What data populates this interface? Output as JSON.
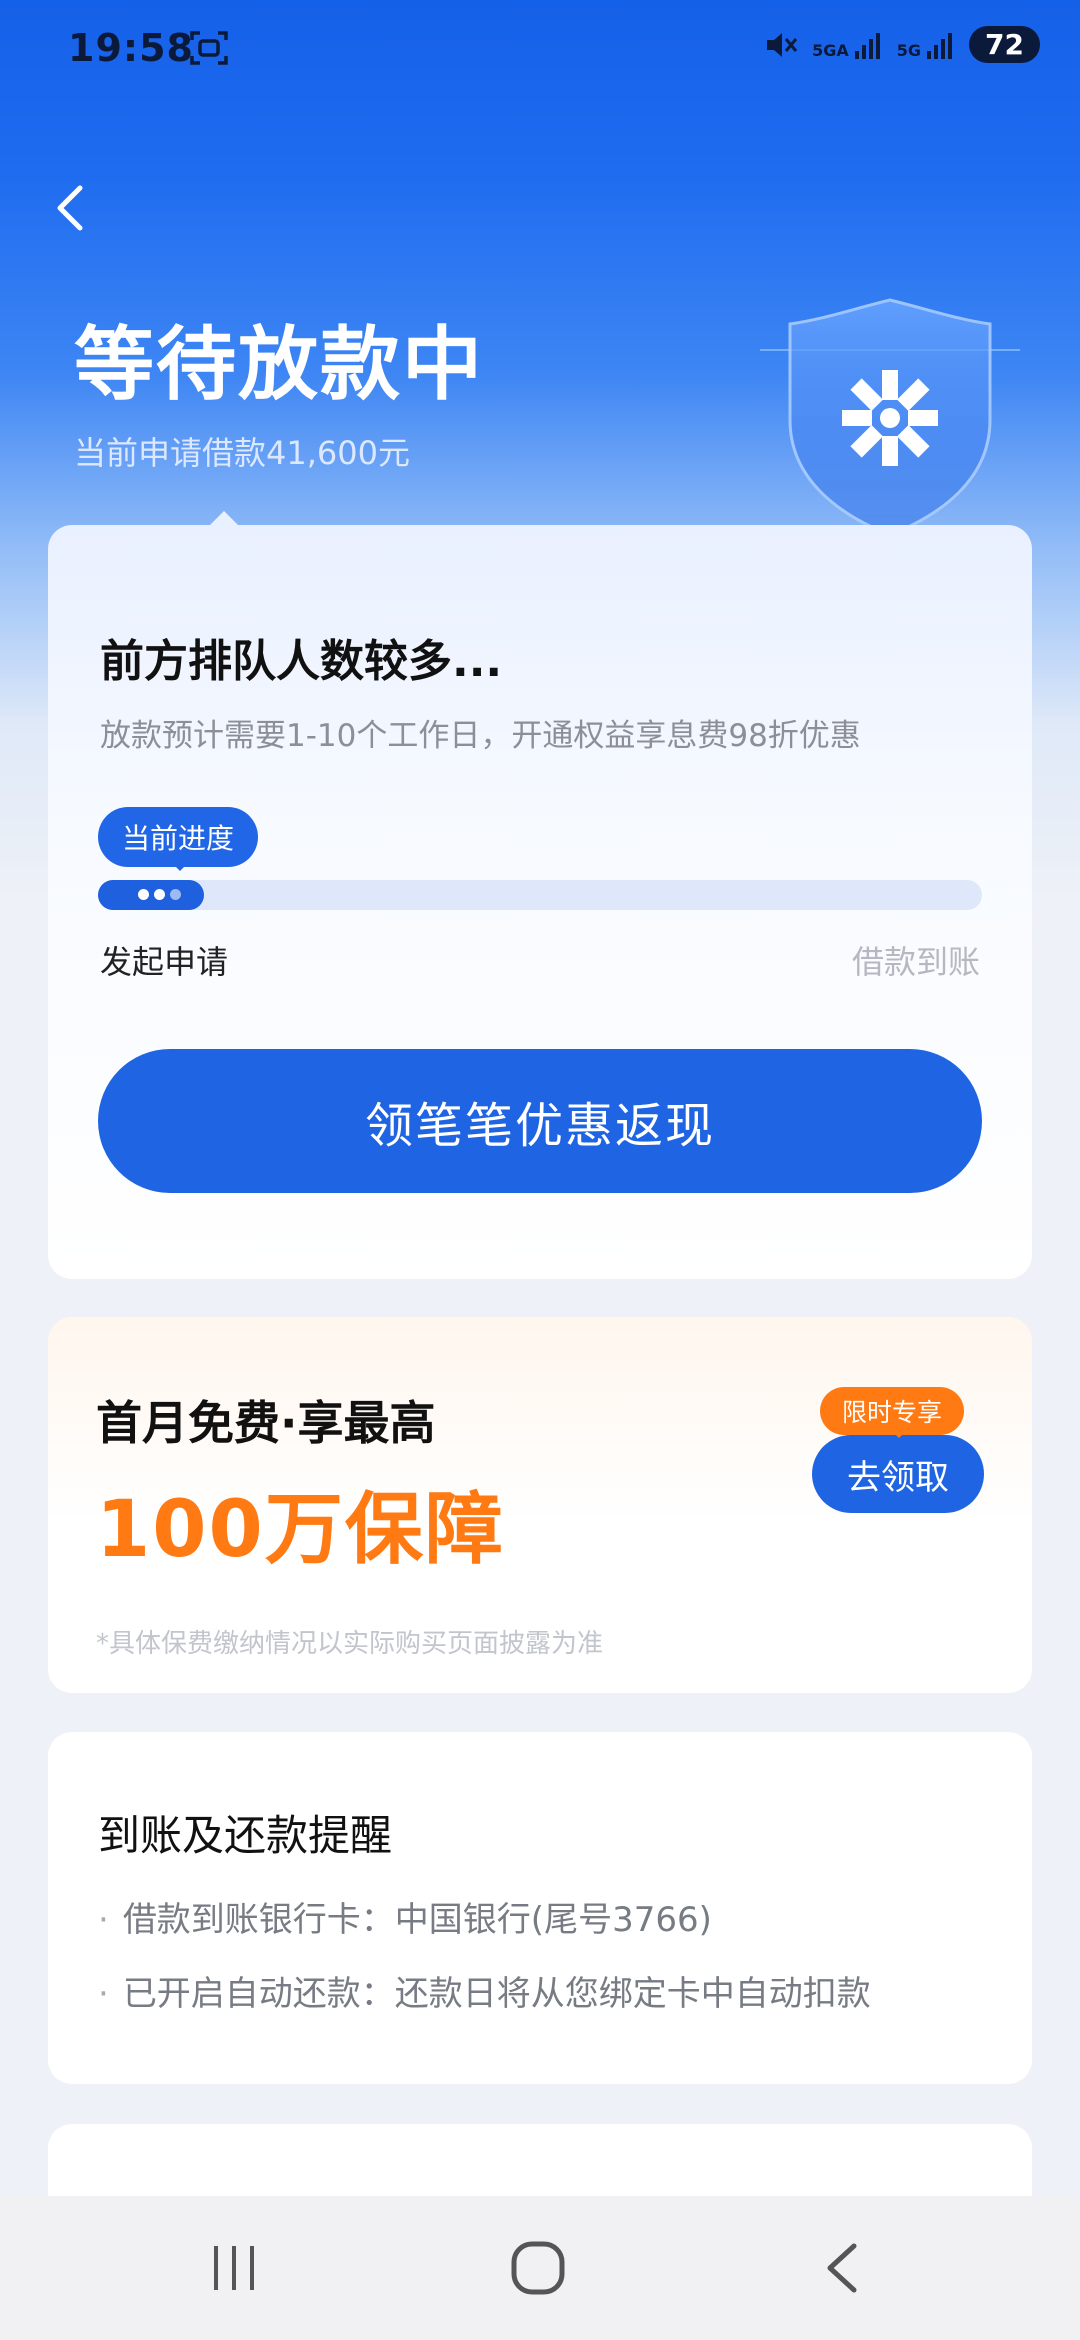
{
  "status_bar": {
    "time": "19:58",
    "signal1_label": "5GA",
    "signal2_label": "5G",
    "battery": "72"
  },
  "header": {
    "title": "等待放款中",
    "subtitle": "当前申请借款41,600元"
  },
  "queue_card": {
    "title": "前方排队人数较多...",
    "description": "放款预计需要1-10个工作日，开通权益享息费98折优惠",
    "progress_tag": "当前进度",
    "progress_fraction": 0.12,
    "step_start": "发起申请",
    "step_end": "借款到账",
    "cta_label": "领笔笔优惠返现"
  },
  "promo_card": {
    "line1": "首月免费·享最高",
    "line2": "100万保障",
    "badge": "限时专享",
    "button": "去领取",
    "note": "*具体保费缴纳情况以实际购买页面披露为准"
  },
  "reminder_card": {
    "title": "到账及还款提醒",
    "items": [
      "借款到账银行卡：中国银行(尾号3766)",
      "已开启自动还款：还款日将从您绑定卡中自动扣款"
    ]
  },
  "colors": {
    "primary": "#1f64e3",
    "accent_orange": "#ff7a12"
  }
}
